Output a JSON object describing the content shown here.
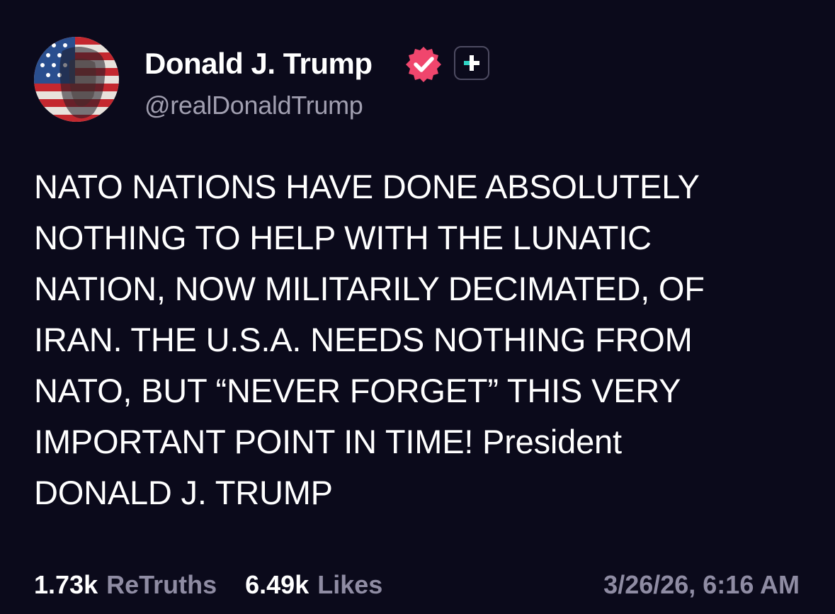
{
  "post": {
    "display_name": "Donald J. Trump",
    "handle": "@realDonaldTrump",
    "text": "NATO NATIONS HAVE DONE ABSOLUTELY\nNOTHING TO HELP WITH THE LUNATIC\nNATION, NOW MILITARILY DECIMATED, OF\nIRAN. THE U.S.A. NEEDS NOTHING FROM\nNATO, BUT “NEVER FORGET” THIS VERY\nIMPORTANT POINT IN TIME! President\nDONALD J. TRUMP",
    "retruths_count": "1.73k",
    "retruths_label": "ReTruths",
    "likes_count": "6.49k",
    "likes_label": "Likes",
    "timestamp": "3/26/26, 6:16 AM"
  },
  "icons": {
    "avatar": "flag-portrait-avatar",
    "verified": "verified-badge-icon",
    "plus": "plus-badge-icon"
  },
  "colors": {
    "background": "#0b0a1b",
    "text_primary": "#ffffff",
    "text_secondary": "#8f8ca3",
    "verified_badge": "#f0466d",
    "plus_accent": "#2fd4c4"
  }
}
